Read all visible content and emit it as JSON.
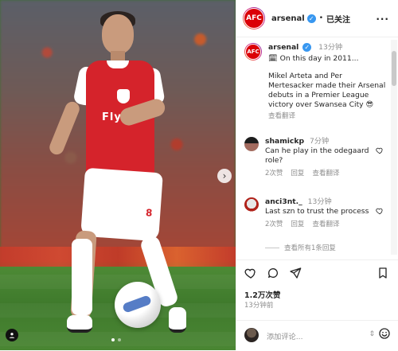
{
  "post": {
    "image": {
      "sponsor_text": "Fly",
      "number": "8"
    },
    "header": {
      "avatar_text": "AFC",
      "username": "arsenal",
      "separator": "•",
      "follow_label": "已关注",
      "more_label": "..."
    },
    "caption": {
      "username": "arsenal",
      "time": "13分钟",
      "line1": "On this day in 2011...",
      "line2": "Mikel Arteta and Per Mertesacker made their Arsenal debuts in a Premier League victory over Swansea City 😎",
      "translate": "查看翻译"
    },
    "comments": [
      {
        "username": "shamickp",
        "time": "7分钟",
        "text": "Can he play in the odegaard role?",
        "replies_label": "2次赞",
        "reply_label": "回复",
        "translate": "查看翻译"
      },
      {
        "username": "anci3nt._",
        "time": "13分钟",
        "text": "Last szn to trust the process",
        "replies_label": "2次赞",
        "reply_label": "回复",
        "translate": "查看翻译"
      }
    ],
    "view_all_replies": "查看所有1条回复",
    "likes": "1.2万次赞",
    "posted": "13分钟前",
    "add_comment_placeholder": "添加评论...",
    "emoji_icon": "emoji-icon",
    "updown": "⇕"
  }
}
